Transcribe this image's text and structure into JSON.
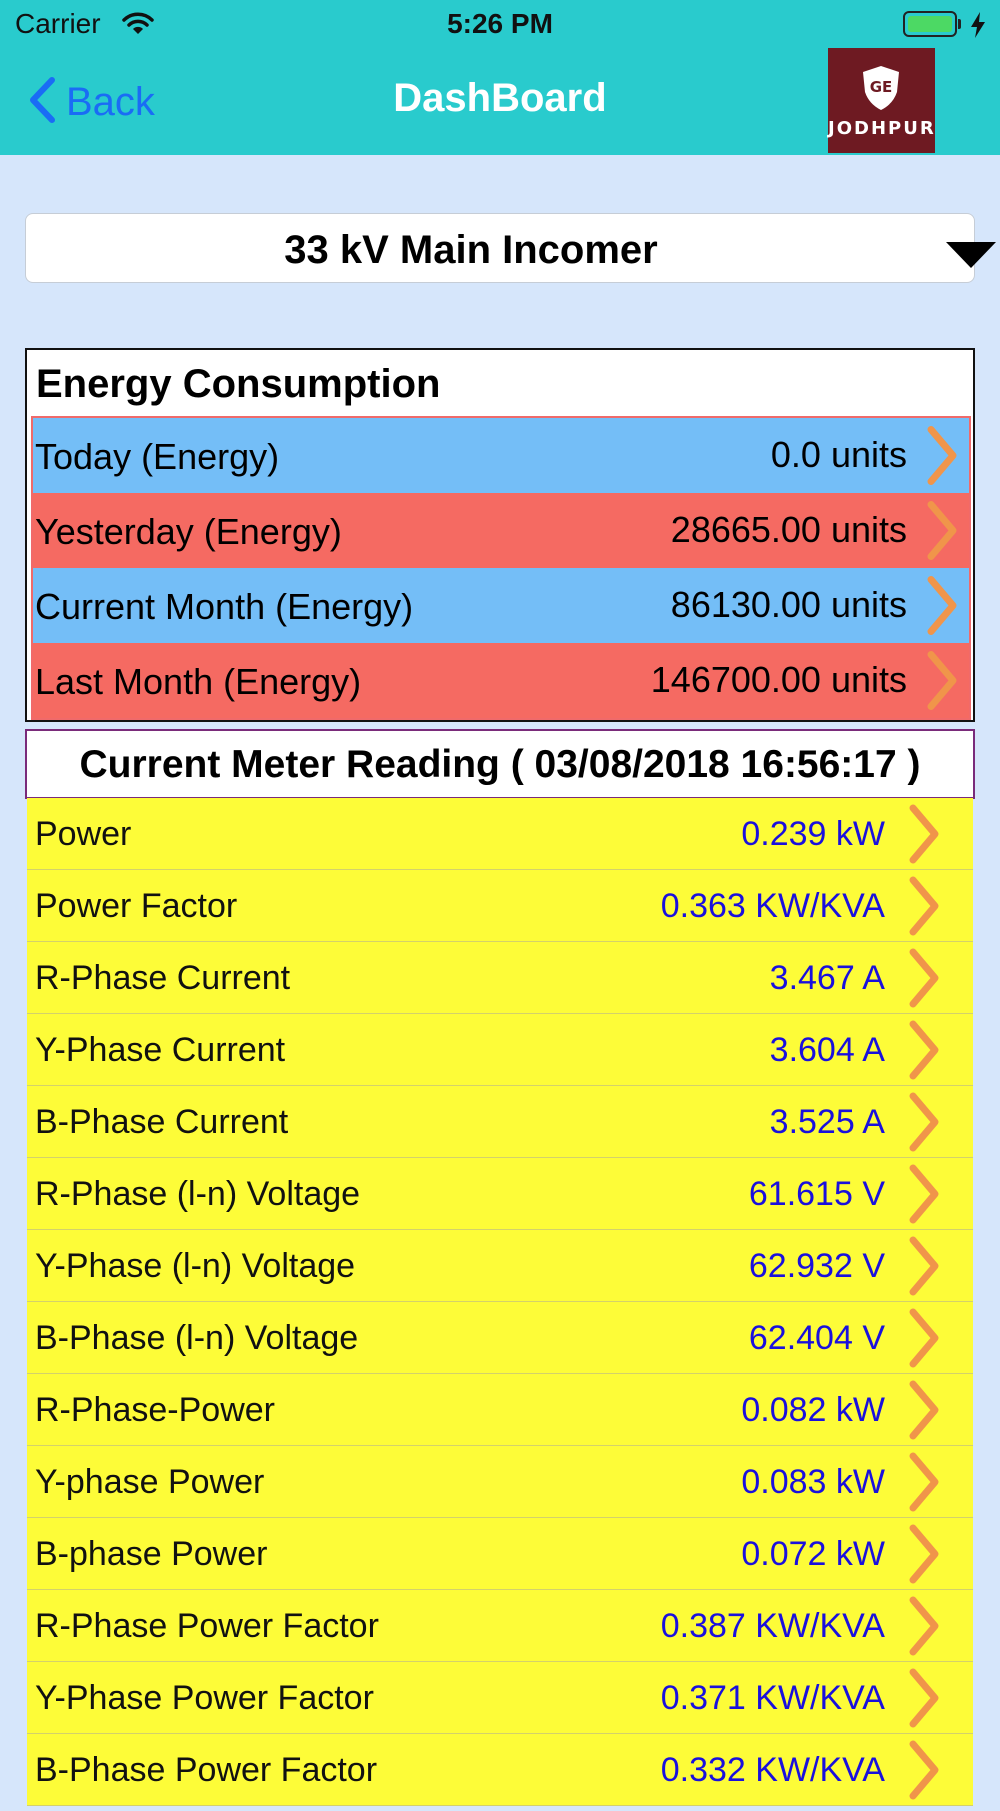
{
  "status_bar": {
    "carrier": "Carrier",
    "time": "5:26 PM"
  },
  "nav": {
    "back_label": "Back",
    "title": "DashBoard",
    "logo_text": "JODHPUR",
    "logo_badge": "GE"
  },
  "dropdown": {
    "selected": "33 kV Main Incomer"
  },
  "energy": {
    "title": "Energy Consumption",
    "rows": [
      {
        "label": "Today (Energy)",
        "value": "0.0 units",
        "color": "#74bef7"
      },
      {
        "label": "Yesterday (Energy)",
        "value": "28665.00 units",
        "color": "#f56a62"
      },
      {
        "label": "Current Month (Energy)",
        "value": "86130.00 units",
        "color": "#74bef7"
      },
      {
        "label": "Last Month (Energy)",
        "value": "146700.00 units",
        "color": "#f56a62"
      }
    ]
  },
  "reading": {
    "title": "Current Meter Reading ( 03/08/2018 16:56:17 )",
    "rows": [
      {
        "label": "Power",
        "value": "0.239 kW"
      },
      {
        "label": "Power Factor",
        "value": "0.363 KW/KVA"
      },
      {
        "label": "R-Phase Current",
        "value": "3.467 A"
      },
      {
        "label": "Y-Phase Current",
        "value": "3.604 A"
      },
      {
        "label": "B-Phase Current",
        "value": "3.525 A"
      },
      {
        "label": "R-Phase (l-n) Voltage",
        "value": "61.615 V"
      },
      {
        "label": "Y-Phase (l-n) Voltage",
        "value": "62.932 V"
      },
      {
        "label": "B-Phase (l-n) Voltage",
        "value": "62.404 V"
      },
      {
        "label": "R-Phase-Power",
        "value": "0.082 kW"
      },
      {
        "label": "Y-phase Power",
        "value": "0.083 kW"
      },
      {
        "label": "B-phase Power",
        "value": "0.072 kW"
      },
      {
        "label": "R-Phase Power Factor",
        "value": "0.387 KW/KVA"
      },
      {
        "label": "Y-Phase Power Factor",
        "value": "0.371 KW/KVA"
      },
      {
        "label": "B-Phase Power Factor",
        "value": "0.332 KW/KVA"
      }
    ]
  },
  "colors": {
    "header": "#29cbcd",
    "background": "#d6e6fb",
    "reading_row": "#fdfc38",
    "value_text": "#1a10dd",
    "chevron": "#f0954a",
    "back": "#1a6cf5"
  }
}
